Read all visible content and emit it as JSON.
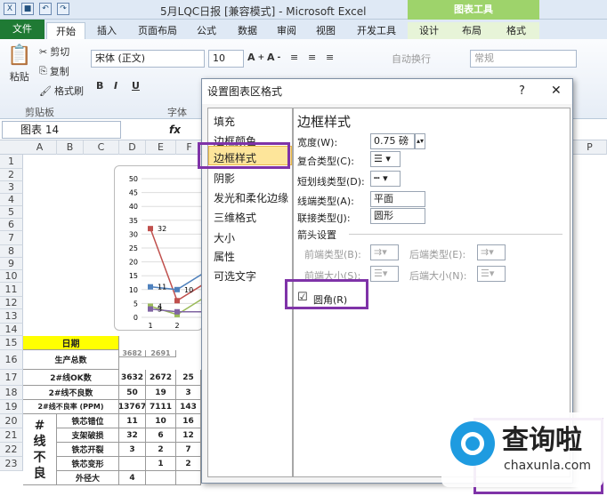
{
  "window": {
    "title": "5月LQC日报 [兼容模式] - Microsoft Excel",
    "context_tab_group": "图表工具"
  },
  "ribbon_tabs": [
    "文件",
    "开始",
    "插入",
    "页面布局",
    "公式",
    "数据",
    "审阅",
    "视图",
    "开发工具",
    "设计",
    "布局",
    "格式"
  ],
  "ribbon": {
    "paste": "粘贴",
    "cut": "剪切",
    "copy": "复制",
    "format_painter": "格式刷",
    "clipboard_group": "剪贴板",
    "font_name": "宋体 (正文)",
    "font_size": "10",
    "font_group": "字体",
    "wrap_text": "自动换行",
    "number_format": "常规"
  },
  "formula_bar": {
    "name_box": "图表 14",
    "fx": "fx"
  },
  "columns": [
    "A",
    "B",
    "C",
    "D",
    "E",
    "F",
    "P"
  ],
  "rows": [
    "1",
    "2",
    "3",
    "4",
    "5",
    "6",
    "7",
    "8",
    "9",
    "10",
    "11",
    "12",
    "13",
    "14",
    "15",
    "16",
    "17",
    "18",
    "19",
    "20",
    "21",
    "22",
    "23"
  ],
  "table": {
    "r14": {
      "label": "日期"
    },
    "r15": {
      "label": "生产总数",
      "d": "3682",
      "e": "2691"
    },
    "r16": {
      "label": "2#线OK数",
      "d": "3632",
      "e": "2672",
      "f": "25"
    },
    "r17": {
      "label": "2#线不良数",
      "d": "50",
      "e": "19",
      "f": "3"
    },
    "r18": {
      "label": "2#线不良率 (PPM)",
      "d": "13767",
      "e": "7111",
      "f": "143"
    },
    "side_label": [
      "#",
      "线",
      "不",
      "良"
    ],
    "defects": [
      {
        "name": "铁芯错位",
        "d": "11",
        "e": "10",
        "f": "16"
      },
      {
        "name": "支架破损",
        "d": "32",
        "e": "6",
        "f": "12"
      },
      {
        "name": "铁芯开裂",
        "d": "3",
        "e": "2",
        "f": "7"
      },
      {
        "name": "铁芯变形",
        "d": "",
        "e": "1",
        "f": "2"
      },
      {
        "name": "外径大",
        "d": "4",
        "e": "",
        "f": ""
      }
    ]
  },
  "chart_data": {
    "type": "line",
    "x": [
      "1",
      "2",
      "3"
    ],
    "ylim": [
      0,
      50
    ],
    "yticks": [
      "0",
      "5",
      "10",
      "15",
      "20",
      "25",
      "30",
      "35",
      "40",
      "45",
      "50"
    ],
    "series": [
      {
        "values": [
          32,
          6,
          12
        ],
        "color": "#c0504d"
      },
      {
        "values": [
          11,
          10,
          16
        ],
        "color": "#4f81bd"
      },
      {
        "values": [
          4,
          1,
          7
        ],
        "color": "#9bbb59"
      },
      {
        "values": [
          3,
          2,
          2
        ],
        "color": "#8064a2"
      }
    ],
    "data_labels": [
      "32",
      "11",
      "10",
      "4",
      "3"
    ]
  },
  "dialog": {
    "title": "设置图表区格式",
    "help": "?",
    "close": "✕",
    "nav": [
      "填充",
      "边框颜色",
      "边框样式",
      "阴影",
      "发光和柔化边缘",
      "三维格式",
      "大小",
      "属性",
      "可选文字"
    ],
    "selected_nav": "边框样式",
    "heading": "边框样式",
    "width_label": "宽度(W):",
    "width_value": "0.75 磅",
    "compound_label": "复合类型(C):",
    "dash_label": "短划线类型(D):",
    "cap_label": "线端类型(A):",
    "cap_value": "平面",
    "join_label": "联接类型(J):",
    "join_value": "圆形",
    "arrow_section": "箭头设置",
    "begin_type": "前端类型(B):",
    "end_type": "后端类型(E):",
    "begin_size": "前端大小(S):",
    "end_size": "后端大小(N):",
    "rounded_label": "圆角(R)",
    "rounded_checked": "☑"
  },
  "watermark": {
    "brand": "查询啦",
    "url": "chaxunla.com"
  },
  "colors": {
    "highlight": "#7f33a8",
    "excel_green": "#1f7a34",
    "context_green": "#9ed36b",
    "yellow_fill": "#ffff00"
  }
}
